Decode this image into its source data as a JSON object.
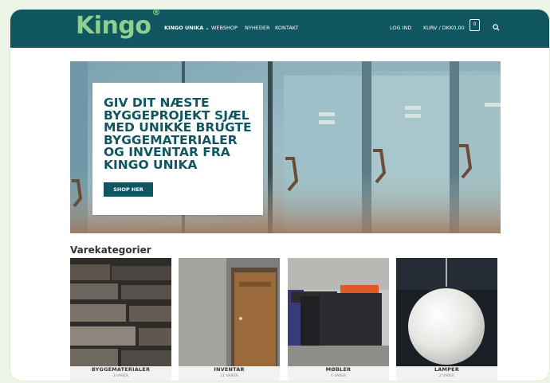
{
  "brand": {
    "logo_text": "Kingo",
    "registered_mark": "®",
    "color_primary": "#0f5661",
    "color_logo": "#8ccf8e"
  },
  "nav": {
    "items": [
      {
        "label": "KINGO UNIKA",
        "chevron": "⌄"
      },
      {
        "label": "WEBSHOP"
      },
      {
        "label": "NYHEDER"
      },
      {
        "label": "KONTAKT"
      }
    ],
    "login": "LOG IND",
    "cart_label": "KURV / DKK0,00",
    "cart_count": "0",
    "search_icon": "search-icon"
  },
  "hero": {
    "title": "GIV DIT NÆSTE\nBYGGEPROJEKT SJÆL\nMED UNIKKE BRUGTE\nBYGGEMATERIALER\nOG INVENTAR FRA\nKINGO UNIKA",
    "button": "SHOP HER"
  },
  "categories": {
    "title": "Varekategorier",
    "items": [
      {
        "name": "BYGGEMATERIALER",
        "count": "3 VARER"
      },
      {
        "name": "INVENTAR",
        "count": "11 VARER"
      },
      {
        "name": "MØBLER",
        "count": "4 VARER"
      },
      {
        "name": "LAMPER",
        "count": "2 VARER"
      }
    ]
  }
}
